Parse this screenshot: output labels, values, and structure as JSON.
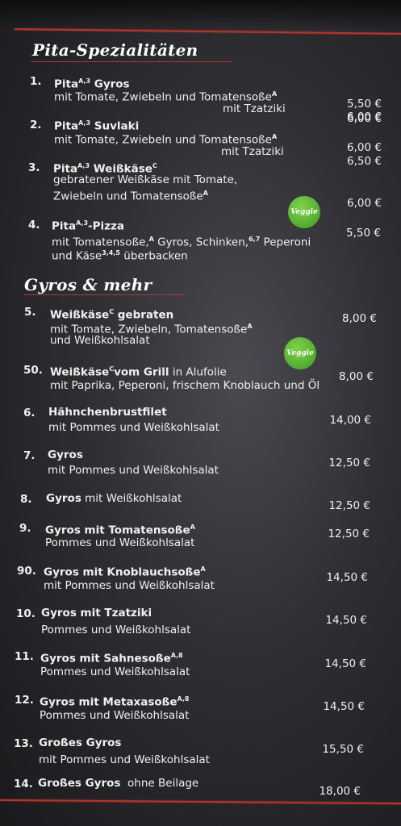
{
  "sections": {
    "pita": "Pita-Spezialitäten",
    "gyros": "Gyros & mehr"
  },
  "badge": "Veggie",
  "items": {
    "p1": {
      "num": "1.",
      "name": "Pita",
      "name_sup": "A,3",
      "name_rest": " Gyros",
      "desc1": "mit Tomate, Zwiebeln und Tomatensoße",
      "desc1_sup": "A",
      "desc2": "mit Tzatziki",
      "price1": "5,50 €",
      "price2": "6,00 €"
    },
    "p2": {
      "num": "2.",
      "name": "Pita",
      "name_sup": "A,3",
      "name_rest": " Suvlaki",
      "desc1": "mit Tomate, Zwiebeln und Tomatensoße",
      "desc1_sup": "A",
      "desc2": "mit Tzatziki",
      "price1": "6,00 €",
      "price2": "6,00 €"
    },
    "p3": {
      "num": "3.",
      "name": "Pita",
      "name_sup": "A,3",
      "name_rest": " Weißkäse",
      "name_sup2": "C",
      "desc1": "gebratener Weißkäse mit Tomate,",
      "desc2": "Zwiebeln und Tomatensoße",
      "desc2_sup": "A",
      "price1": "6,50 €",
      "price2": "6,00 €"
    },
    "p4": {
      "num": "4.",
      "name": "Pita",
      "name_sup": "A,3",
      "name_rest": "-Pizza",
      "desc1a": "mit Tomatensoße,",
      "desc1a_sup": "A",
      "desc1b": " Gyros, Schinken,",
      "desc1b_sup": "6,7",
      "desc1c": " Peperoni",
      "desc2": "und Käse",
      "desc2_sup": "3,4,5",
      "desc2b": " überbacken",
      "price": "5,50 €"
    },
    "g5": {
      "num": "5.",
      "name": "Weißkäse",
      "name_sup": "C",
      "name_rest": " gebraten",
      "desc1": "mit Tomate, Zwiebeln, Tomatensoße",
      "desc1_sup": "A",
      "desc2": "und Weißkohlsalat",
      "price": "8,00 €"
    },
    "g50": {
      "num": "50.",
      "name": "Weißkäse",
      "name_sup": "C",
      "name_rest": "vom Grill",
      "name_normal": " in Alufolie",
      "desc1": "mit Paprika, Peperoni, frischem Knoblauch und Öl",
      "price": "8,00 €"
    },
    "g6": {
      "num": "6.",
      "name": "Hähnchenbrustfilet",
      "desc1": "mit Pommes und Weißkohlsalat",
      "price": "14,00 €"
    },
    "g7": {
      "num": "7.",
      "name": "Gyros",
      "desc1": "mit Pommes und Weißkohlsalat",
      "price": "12,50 €"
    },
    "g8": {
      "num": "8.",
      "name": "Gyros",
      "name_normal": " mit Weißkohlsalat",
      "price": "12,50 €"
    },
    "g9": {
      "num": "9.",
      "name": "Gyros mit Tomatensoße",
      "name_sup": "A",
      "desc1": "Pommes und Weißkohlsalat",
      "price": "12,50 €"
    },
    "g90": {
      "num": "90.",
      "name": "Gyros mit Knoblauchsoße",
      "name_sup": "A",
      "desc1": "mit Pommes und Weißkohlsalat",
      "price": "14,50 €"
    },
    "g10": {
      "num": "10.",
      "name": "Gyros mit Tzatziki",
      "desc1": "Pommes und Weißkohlsalat",
      "price": "14,50 €"
    },
    "g11": {
      "num": "11.",
      "name": "Gyros mit Sahnesoße",
      "name_sup": "A,8",
      "desc1": "Pommes und Weißkohlsalat",
      "price": "14,50 €"
    },
    "g12": {
      "num": "12.",
      "name": "Gyros mit Metaxasoße",
      "name_sup": "A,8",
      "desc1": "Pommes und Weißkohlsalat",
      "price": "14,50 €"
    },
    "g13": {
      "num": "13.",
      "name": "Großes Gyros",
      "desc1": "mit Pommes und Weißkohlsalat",
      "price": "15,50 €"
    },
    "g14": {
      "num": "14.",
      "name": "Großes Gyros",
      "name_normal": "  ohne Beilage",
      "price": "18,00 €"
    }
  }
}
